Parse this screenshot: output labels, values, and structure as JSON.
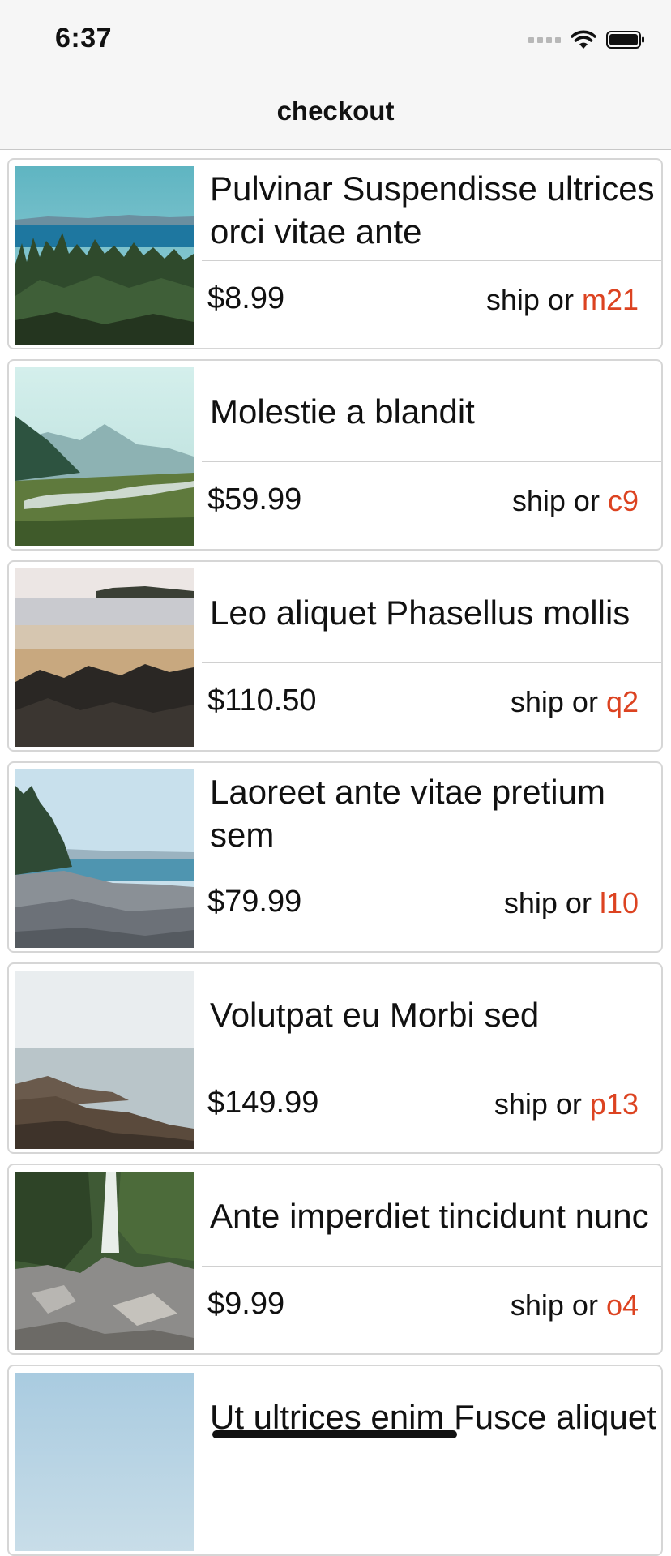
{
  "status_bar": {
    "time": "6:37",
    "icons": [
      "cellular-signal-icon",
      "wifi-icon",
      "battery-icon"
    ]
  },
  "nav": {
    "title": "checkout"
  },
  "colors": {
    "ship_code": "#dc4321",
    "card_border": "#d6d6d6",
    "bar_background": "#f6f6f6"
  },
  "ship_label": "ship or",
  "items": [
    {
      "title": "Pulvinar Suspendisse ultrices orci vitae ante",
      "price": "$8.99",
      "ship_code": "m21",
      "image": "forest-lake-photo"
    },
    {
      "title": "Molestie a blandit",
      "price": "$59.99",
      "ship_code": "c9",
      "image": "misty-river-valley-photo"
    },
    {
      "title": "Leo aliquet Phasellus mollis",
      "price": "$110.50",
      "ship_code": "q2",
      "image": "rocky-beach-photo"
    },
    {
      "title": "Laoreet ante vitae pretium sem",
      "price": "$79.99",
      "ship_code": "l10",
      "image": "pebble-shore-photo"
    },
    {
      "title": "Volutpat eu Morbi sed",
      "price": "$149.99",
      "ship_code": "p13",
      "image": "rocky-coast-photo"
    },
    {
      "title": "Ante imperdiet tincidunt nunc",
      "price": "$9.99",
      "ship_code": "o4",
      "image": "waterfall-photo"
    },
    {
      "title": "Ut ultrices enim Fusce aliquet",
      "price": "",
      "ship_code": "",
      "image": "sky-photo"
    }
  ]
}
